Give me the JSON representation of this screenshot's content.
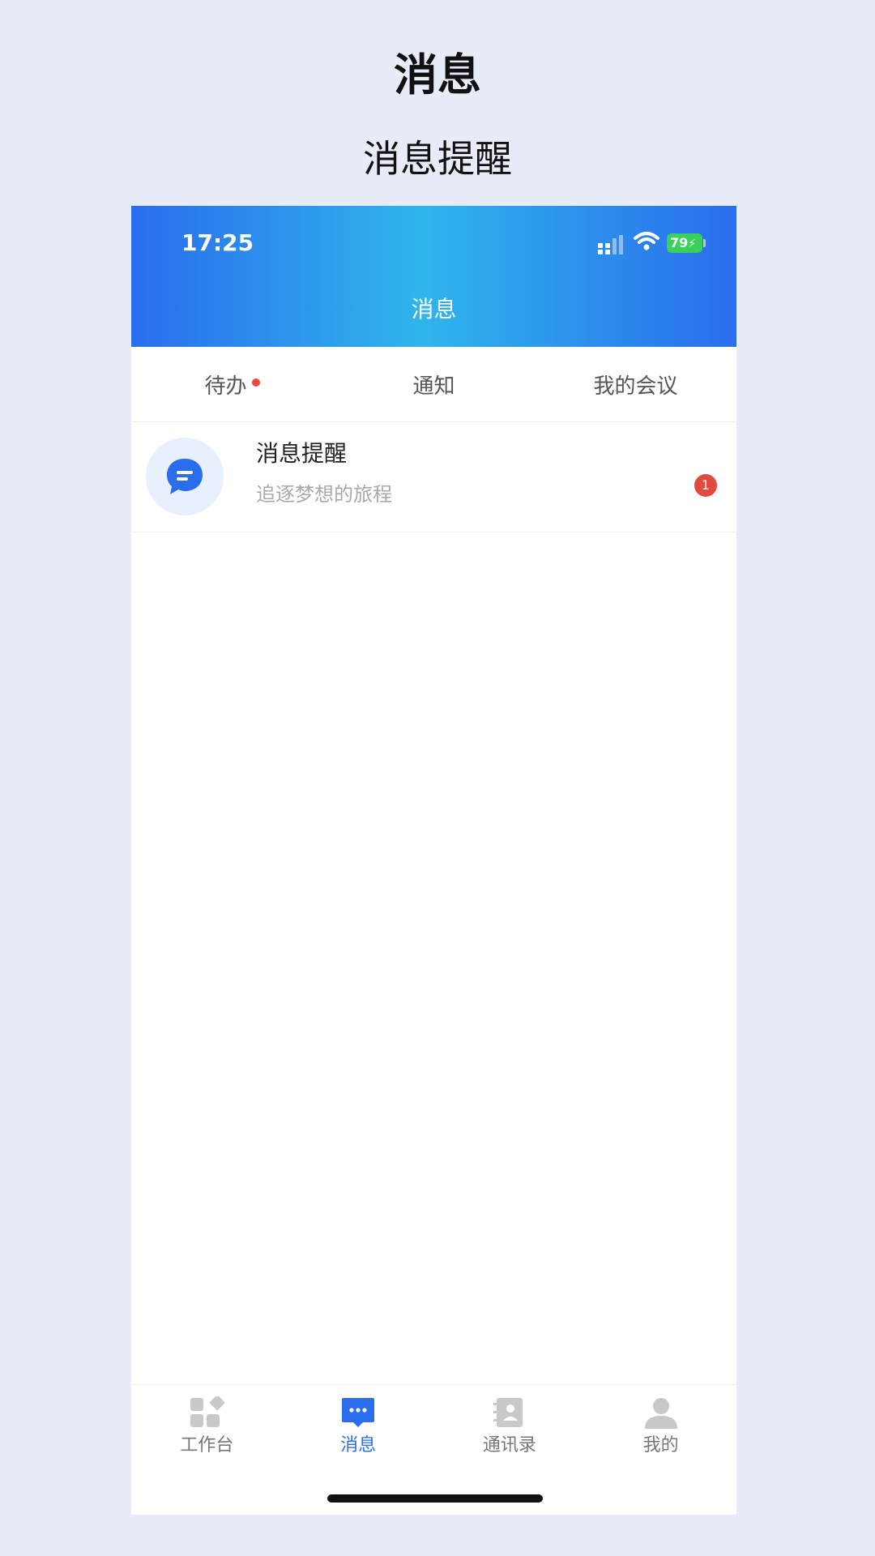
{
  "page": {
    "heading": "消息",
    "subheading": "消息提醒"
  },
  "status_bar": {
    "time": "17:25",
    "battery": "79"
  },
  "header": {
    "title": "消息"
  },
  "tabs": [
    {
      "label": "待办",
      "has_dot": true
    },
    {
      "label": "通知",
      "has_dot": false
    },
    {
      "label": "我的会议",
      "has_dot": false
    }
  ],
  "messages": [
    {
      "title": "消息提醒",
      "subtitle": "追逐梦想的旅程",
      "badge": "1",
      "icon": "chat-bubble-icon"
    }
  ],
  "tabbar": [
    {
      "label": "工作台",
      "icon": "workbench-icon",
      "active": false
    },
    {
      "label": "消息",
      "icon": "message-icon",
      "active": true
    },
    {
      "label": "通讯录",
      "icon": "contacts-icon",
      "active": false
    },
    {
      "label": "我的",
      "icon": "profile-icon",
      "active": false
    }
  ],
  "colors": {
    "brand": "#2a6ded",
    "header_gradient_mid": "#2fb5ec",
    "badge": "#e24a3f",
    "page_bg": "#e7ecf8"
  }
}
